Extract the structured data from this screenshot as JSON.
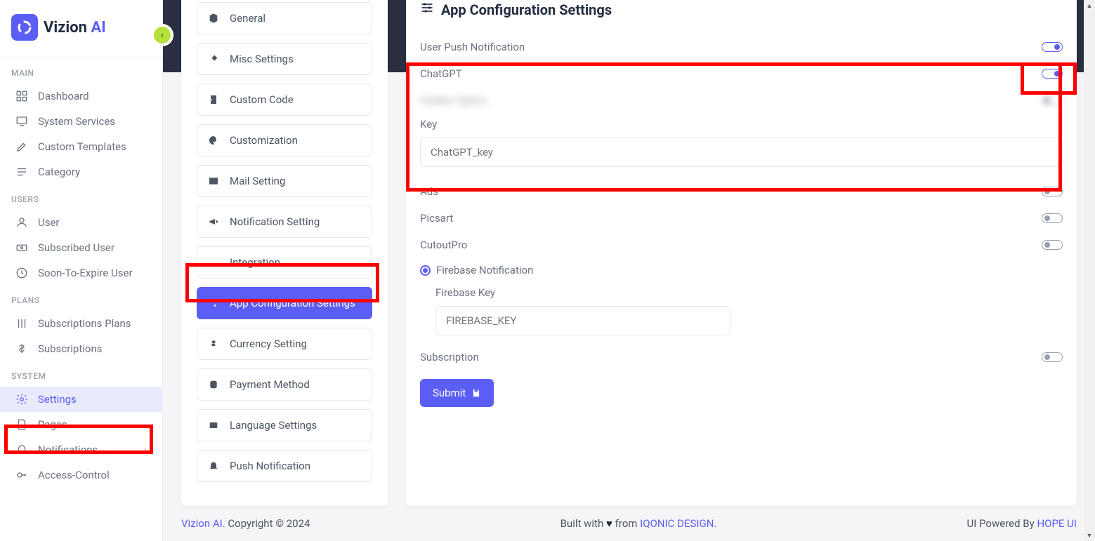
{
  "brand": {
    "name": "Vizion",
    "suffix": "AI"
  },
  "sidebar": {
    "sections": {
      "main": {
        "label": "MAIN",
        "items": [
          {
            "label": "Dashboard"
          },
          {
            "label": "System Services"
          },
          {
            "label": "Custom Templates"
          },
          {
            "label": "Category"
          }
        ]
      },
      "users": {
        "label": "USERS",
        "items": [
          {
            "label": "User"
          },
          {
            "label": "Subscribed User"
          },
          {
            "label": "Soon-To-Expire User"
          }
        ]
      },
      "plans": {
        "label": "PLANS",
        "items": [
          {
            "label": "Subscriptions Plans"
          },
          {
            "label": "Subscriptions"
          }
        ]
      },
      "system": {
        "label": "SYSTEM",
        "items": [
          {
            "label": "Settings"
          },
          {
            "label": "Pages"
          },
          {
            "label": "Notifications"
          },
          {
            "label": "Access-Control"
          }
        ]
      }
    }
  },
  "settingsMenu": {
    "items": [
      {
        "label": "General"
      },
      {
        "label": "Misc Settings"
      },
      {
        "label": "Custom Code"
      },
      {
        "label": "Customization"
      },
      {
        "label": "Mail Setting"
      },
      {
        "label": "Notification Setting"
      },
      {
        "label": "Integration"
      },
      {
        "label": "App Configuration Settings"
      },
      {
        "label": "Currency Setting"
      },
      {
        "label": "Payment Method"
      },
      {
        "label": "Language Settings"
      },
      {
        "label": "Push Notification"
      }
    ]
  },
  "config": {
    "title": "App Configuration Settings",
    "rows": {
      "userPush": "User Push Notification",
      "chatgpt": "ChatGPT",
      "hidden": "Hidden Option",
      "key": "Key",
      "keyPlaceholder": "ChatGPT_key",
      "ads": "Ads",
      "picsart": "Picsart",
      "cutoutpro": "CutoutPro",
      "firebase": "Firebase Notification",
      "firebaseKey": "Firebase Key",
      "firebaseKeyPlaceholder": "FIREBASE_KEY",
      "subscription": "Subscription",
      "submit": "Submit"
    }
  },
  "footer": {
    "brand": "Vizion AI.",
    "copyright": " Copyright © 2024",
    "built1": "Built with ",
    "heart": "♥",
    "built2": " from ",
    "iqonic": "IQONIC DESIGN.",
    "ui": "UI Powered By ",
    "hope": "HOPE UI"
  }
}
